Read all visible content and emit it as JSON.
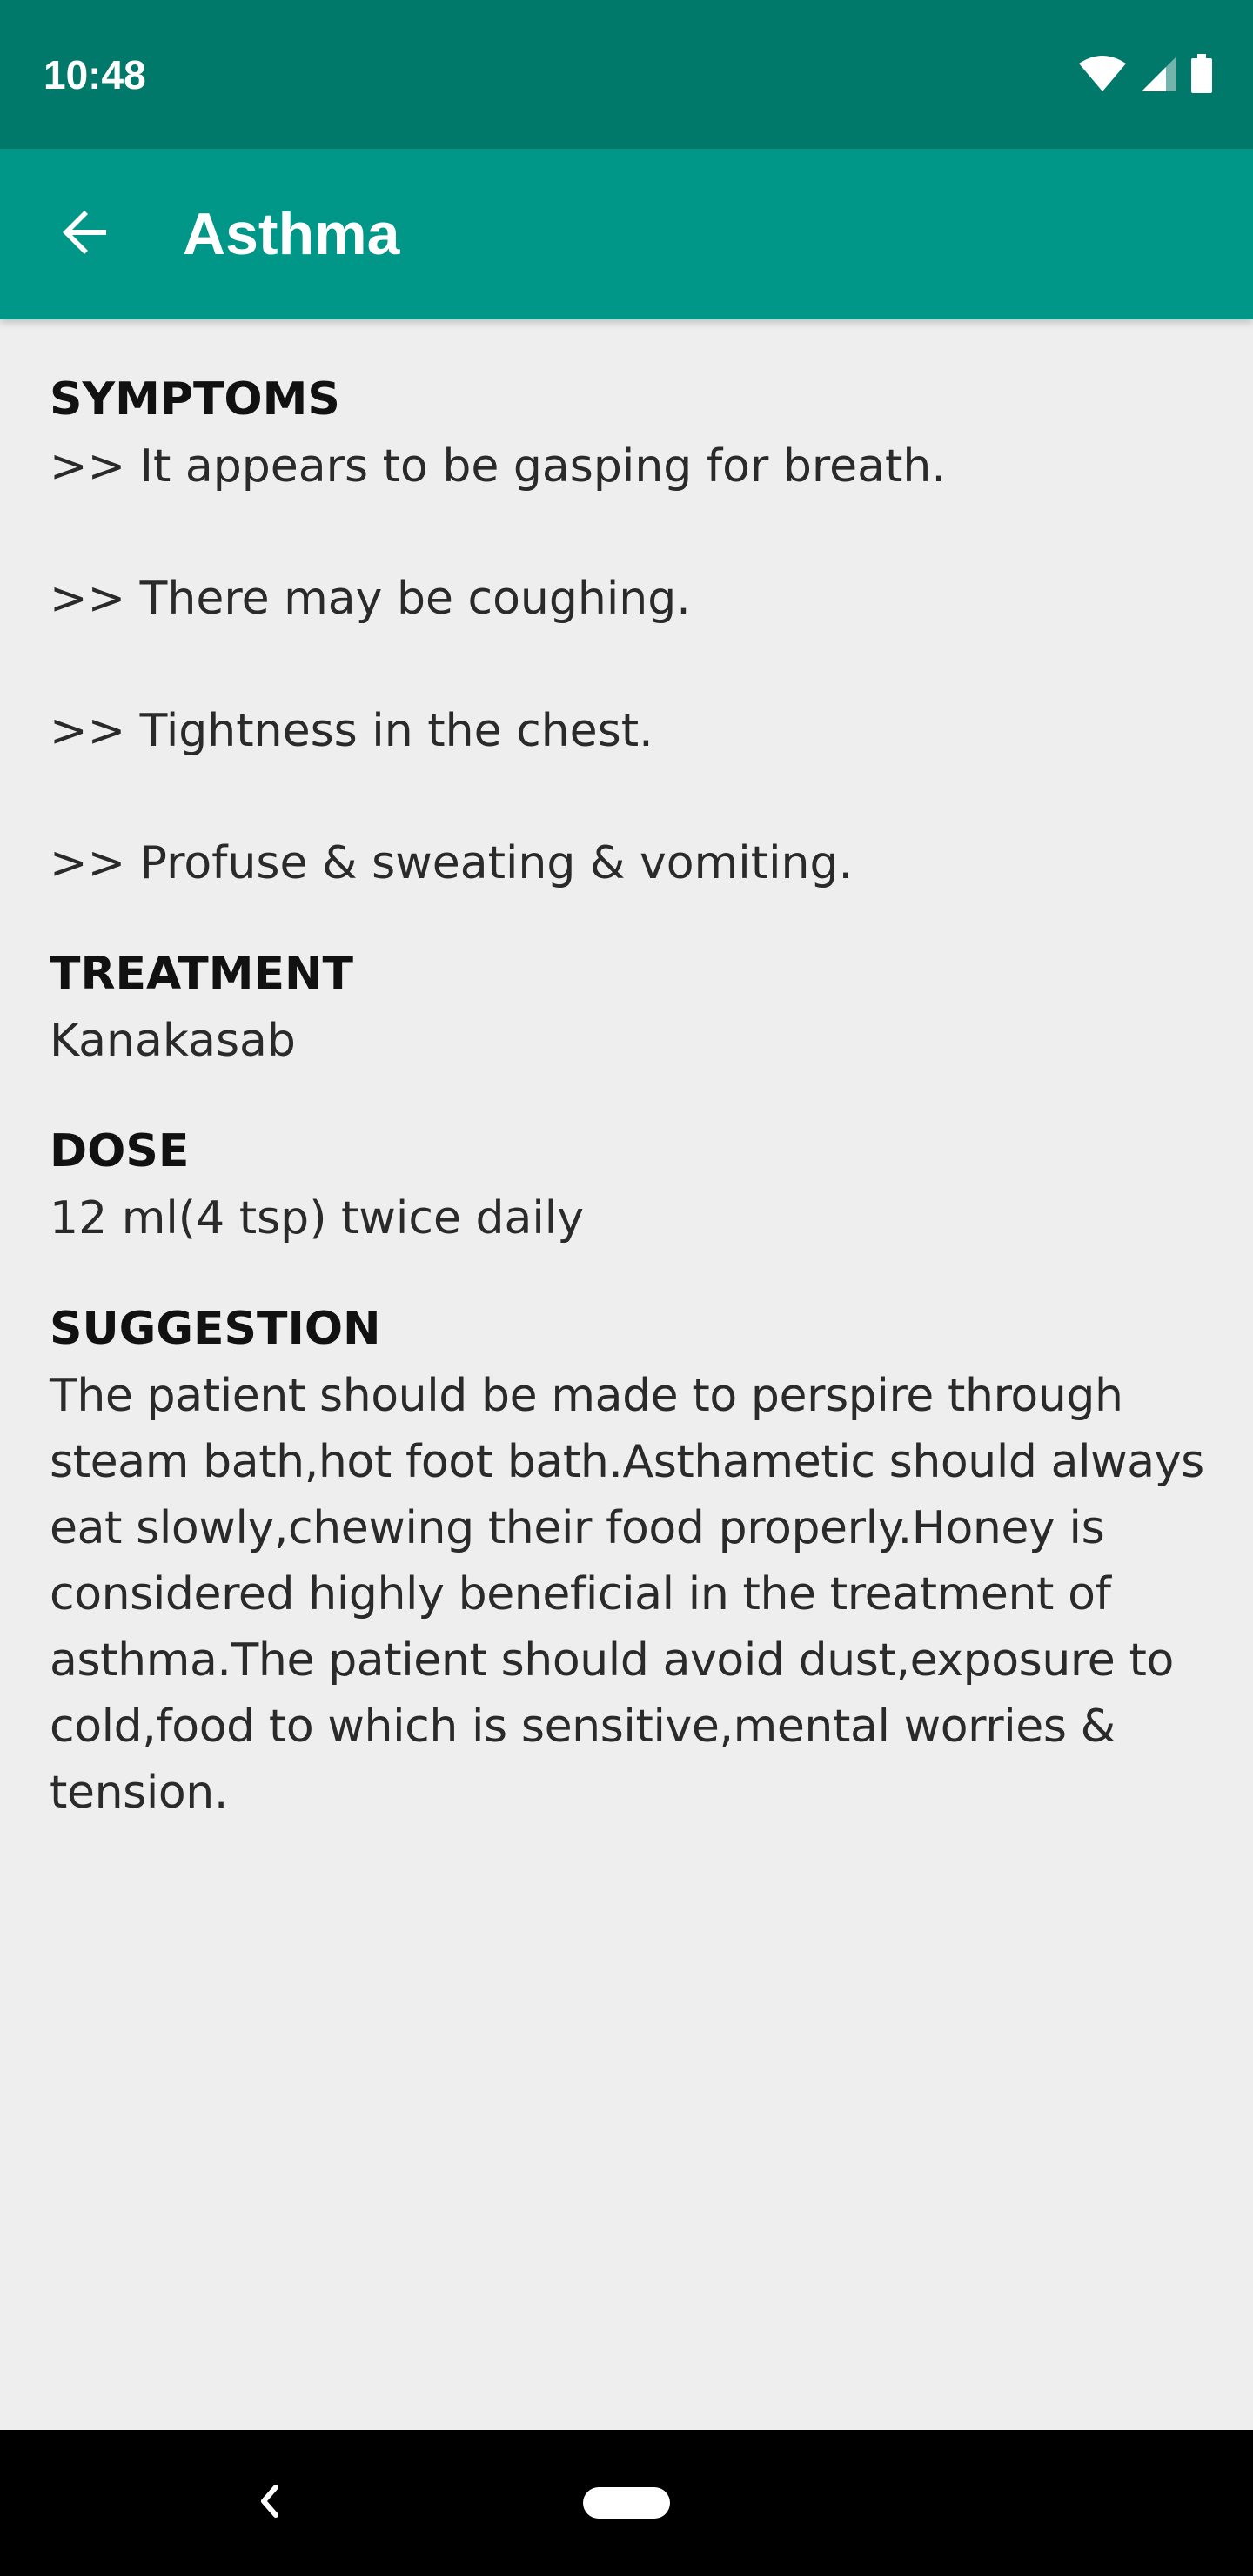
{
  "status_bar": {
    "time": "10:48",
    "icons": [
      "wifi-icon",
      "signal-icon",
      "battery-icon"
    ],
    "background": "#00796b"
  },
  "app_bar": {
    "title": "Asthma",
    "back_icon": "arrow-left-icon",
    "background": "#009688"
  },
  "sections": {
    "symptoms": {
      "heading": "SYMPTOMS",
      "items": [
        ">> It appears to be gasping for breath.",
        ">> There may be coughing.",
        ">> Tightness in the chest.",
        ">> Profuse & sweating & vomiting."
      ]
    },
    "treatment": {
      "heading": "TREATMENT",
      "text": "Kanakasab"
    },
    "dose": {
      "heading": "DOSE",
      "text": "12 ml(4 tsp) twice daily"
    },
    "suggestion": {
      "heading": "SUGGESTION",
      "text": "The patient should be made to perspire through steam bath,hot foot bath.Asthametic should always eat slowly,chewing their food properly.Honey is considered highly beneficial in the treatment of asthma.The patient should avoid dust,exposure to cold,food to which is sensitive,mental worries & tension."
    }
  },
  "nav_bar": {
    "back_icon": "chevron-left-icon",
    "home_icon": "home-pill-icon"
  }
}
